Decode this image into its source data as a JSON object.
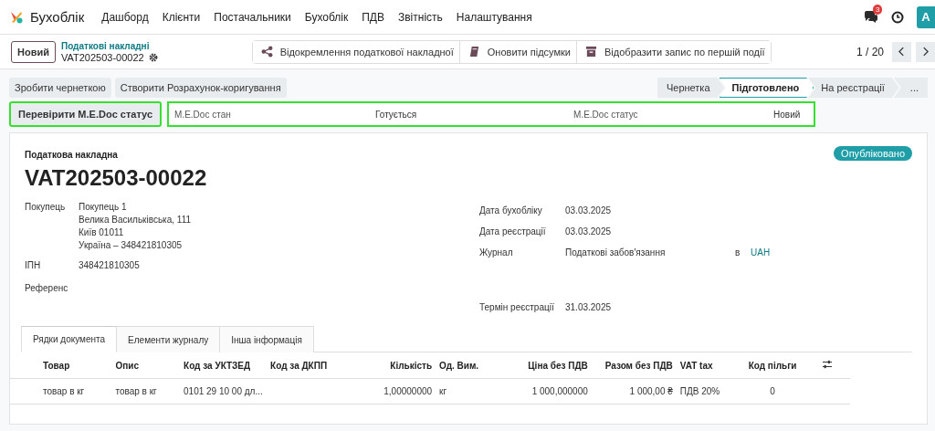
{
  "app": {
    "name": "Бухоблік"
  },
  "menu": [
    "Дашборд",
    "Клієнти",
    "Постачальники",
    "Бухоблік",
    "ПДВ",
    "Звітність",
    "Налаштування"
  ],
  "notifications": {
    "count": "3"
  },
  "avatar": "A",
  "breadcrumb": {
    "new_button": "Новий",
    "parent": "Податкові накладні",
    "record": "VAT202503-00022"
  },
  "actions": [
    {
      "kind": "share",
      "label": "Відокремлення податкової накладної"
    },
    {
      "kind": "book",
      "label": "Оновити підсумки"
    },
    {
      "kind": "archive",
      "label": "Відобразити запис по першій події"
    }
  ],
  "pager": "1 / 20",
  "buttons": [
    "Зробити чернеткою",
    "Створити Розрахунок-коригування"
  ],
  "statusbar": [
    {
      "label": "Чернетка",
      "selected": false
    },
    {
      "label": "Підготовлено",
      "selected": true
    },
    {
      "label": "На реєстрації",
      "selected": false
    }
  ],
  "statusbar_more": "...",
  "medoc": {
    "button": "Перевірити M.E.Doc статус",
    "highlighted": true,
    "fields": [
      {
        "label": "M.E.Doc стан",
        "value": "Готується"
      },
      {
        "label": "M.E.Doc статус",
        "value": "Новий"
      }
    ]
  },
  "sheet": {
    "type_label": "Податкова накладна",
    "name": "VAT202503-00022",
    "badge": "Опубліковано",
    "left": [
      {
        "label": "Покупець",
        "lines": [
          "Покупець 1",
          "Велика Васильківська, 111",
          "Київ 01011",
          "Україна – 348421810305"
        ]
      },
      {
        "label": "ІПН",
        "lines": [
          "348421810305"
        ]
      },
      {
        "label": "Референс"
      }
    ],
    "right": [
      {
        "label": "Дата бухобліку",
        "value": "03.03.2025"
      },
      {
        "label": "Дата реєстрації",
        "value": "03.03.2025"
      },
      {
        "label": "Журнал",
        "value": "Податкові забов'язання",
        "joiner": "в",
        "currency": "UAH"
      },
      {
        "label": "Термін реєстрації",
        "value": "31.03.2025"
      }
    ]
  },
  "tabs": [
    {
      "label": "Рядки документа",
      "selected": true
    },
    {
      "label": "Елементи журналу",
      "selected": false
    },
    {
      "label": "Інша інформація",
      "selected": false
    }
  ],
  "table": {
    "columns": [
      "Товар",
      "Опис",
      "Код за УКТЗЕД",
      "Код за ДКПП",
      "Кількість",
      "Од. Вим.",
      "Ціна без ПДВ",
      "Разом без ПДВ",
      "VAT tax",
      "Код пільги"
    ],
    "rows": [
      [
        "товар в кг",
        "товар в кг",
        "0101 29 10 00 дл...",
        null,
        "1,00000000",
        "кг",
        "1 000,000000",
        "1 000,00 ₴",
        "ПДВ 20%",
        "0"
      ]
    ]
  }
}
